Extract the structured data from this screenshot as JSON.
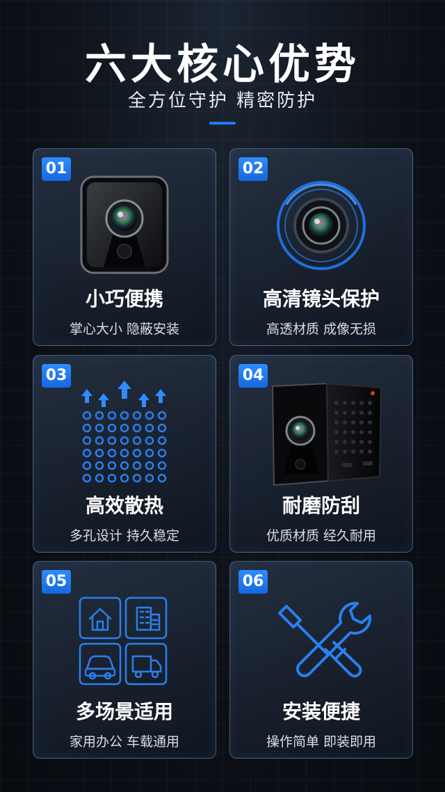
{
  "header": {
    "title": "六大核心优势",
    "subtitle": "全方位守护 精密防护",
    "accent_color": "#1f7cf5"
  },
  "cards": [
    {
      "num": "01",
      "title": "小巧便携",
      "desc": "掌心大小 隐蔽安装",
      "icon": "mini-camera-icon"
    },
    {
      "num": "02",
      "title": "高清镜头保护",
      "desc": "高透材质 成像无损",
      "icon": "lens-icon"
    },
    {
      "num": "03",
      "title": "高效散热",
      "desc": "多孔设计 持久稳定",
      "icon": "heat-vent-icon"
    },
    {
      "num": "04",
      "title": "耐磨防刮",
      "desc": "优质材质 经久耐用",
      "icon": "camera-body-icon"
    },
    {
      "num": "05",
      "title": "多场景适用",
      "desc": "家用办公 车载通用",
      "icon": "scenes-icon"
    },
    {
      "num": "06",
      "title": "安装便捷",
      "desc": "操作简单 即装即用",
      "icon": "tools-icon"
    }
  ]
}
